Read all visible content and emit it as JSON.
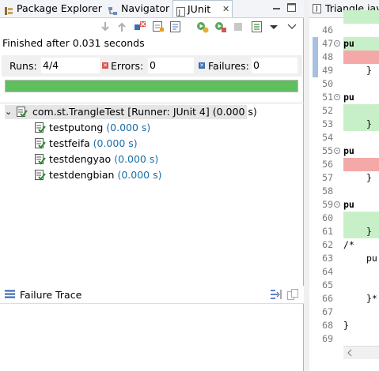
{
  "tabs": {
    "package_explorer": "Package Explorer",
    "navigator": "Navigator",
    "junit": "JUnit",
    "junit_close": "✕"
  },
  "status": {
    "finished": "Finished after 0.031 seconds"
  },
  "counts": {
    "runs_label": "Runs:",
    "runs_value": "4/4",
    "errors_label": "Errors:",
    "errors_value": "0",
    "failures_label": "Failures:",
    "failures_value": "0"
  },
  "progress": {
    "fraction": 1.0,
    "color": "#5fbf5f"
  },
  "tree": {
    "root": {
      "name": "com.st.TrangleTest [Runner: JUnit 4]",
      "time": "(0.000 s)"
    },
    "children": [
      {
        "name": "testputong",
        "time": "(0.000 s)"
      },
      {
        "name": "testfeifa",
        "time": "(0.000 s)"
      },
      {
        "name": "testdengyao",
        "time": "(0.000 s)"
      },
      {
        "name": "testdengbian",
        "time": "(0.000 s)"
      }
    ]
  },
  "failure_trace": {
    "label": "Failure Trace"
  },
  "editor": {
    "tab_label": "Triangle.java",
    "lines": [
      {
        "num": "46",
        "code": ""
      },
      {
        "num": "47",
        "code": "pu"
      },
      {
        "num": "48",
        "code": ""
      },
      {
        "num": "49",
        "code": "}"
      },
      {
        "num": "50",
        "code": ""
      },
      {
        "num": "51",
        "code": "pu"
      },
      {
        "num": "52",
        "code": ""
      },
      {
        "num": "53",
        "code": "}"
      },
      {
        "num": "54",
        "code": ""
      },
      {
        "num": "55",
        "code": "pu"
      },
      {
        "num": "56",
        "code": ""
      },
      {
        "num": "57",
        "code": "}"
      },
      {
        "num": "58",
        "code": ""
      },
      {
        "num": "59",
        "code": "pu"
      },
      {
        "num": "60",
        "code": ""
      },
      {
        "num": "61",
        "code": "}"
      },
      {
        "num": "62",
        "code": "/*"
      },
      {
        "num": "63",
        "code": "pu"
      },
      {
        "num": "64",
        "code": ""
      },
      {
        "num": "65",
        "code": ""
      },
      {
        "num": "66",
        "code": "}*"
      },
      {
        "num": "67",
        "code": ""
      },
      {
        "num": "68",
        "code": "}"
      },
      {
        "num": "69",
        "code": ""
      }
    ]
  },
  "colors": {
    "pass_green": "#5fbf5f",
    "error_red": "#d9534f",
    "failure_blue": "#3a6fb0"
  }
}
